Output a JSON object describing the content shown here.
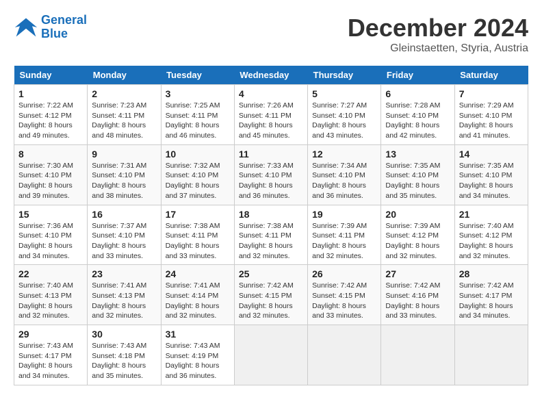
{
  "header": {
    "logo_general": "General",
    "logo_blue": "Blue",
    "month_title": "December 2024",
    "location": "Gleinstaetten, Styria, Austria"
  },
  "weekdays": [
    "Sunday",
    "Monday",
    "Tuesday",
    "Wednesday",
    "Thursday",
    "Friday",
    "Saturday"
  ],
  "weeks": [
    [
      {
        "day": "1",
        "info": "Sunrise: 7:22 AM\nSunset: 4:12 PM\nDaylight: 8 hours\nand 49 minutes."
      },
      {
        "day": "2",
        "info": "Sunrise: 7:23 AM\nSunset: 4:11 PM\nDaylight: 8 hours\nand 48 minutes."
      },
      {
        "day": "3",
        "info": "Sunrise: 7:25 AM\nSunset: 4:11 PM\nDaylight: 8 hours\nand 46 minutes."
      },
      {
        "day": "4",
        "info": "Sunrise: 7:26 AM\nSunset: 4:11 PM\nDaylight: 8 hours\nand 45 minutes."
      },
      {
        "day": "5",
        "info": "Sunrise: 7:27 AM\nSunset: 4:10 PM\nDaylight: 8 hours\nand 43 minutes."
      },
      {
        "day": "6",
        "info": "Sunrise: 7:28 AM\nSunset: 4:10 PM\nDaylight: 8 hours\nand 42 minutes."
      },
      {
        "day": "7",
        "info": "Sunrise: 7:29 AM\nSunset: 4:10 PM\nDaylight: 8 hours\nand 41 minutes."
      }
    ],
    [
      {
        "day": "8",
        "info": "Sunrise: 7:30 AM\nSunset: 4:10 PM\nDaylight: 8 hours\nand 39 minutes."
      },
      {
        "day": "9",
        "info": "Sunrise: 7:31 AM\nSunset: 4:10 PM\nDaylight: 8 hours\nand 38 minutes."
      },
      {
        "day": "10",
        "info": "Sunrise: 7:32 AM\nSunset: 4:10 PM\nDaylight: 8 hours\nand 37 minutes."
      },
      {
        "day": "11",
        "info": "Sunrise: 7:33 AM\nSunset: 4:10 PM\nDaylight: 8 hours\nand 36 minutes."
      },
      {
        "day": "12",
        "info": "Sunrise: 7:34 AM\nSunset: 4:10 PM\nDaylight: 8 hours\nand 36 minutes."
      },
      {
        "day": "13",
        "info": "Sunrise: 7:35 AM\nSunset: 4:10 PM\nDaylight: 8 hours\nand 35 minutes."
      },
      {
        "day": "14",
        "info": "Sunrise: 7:35 AM\nSunset: 4:10 PM\nDaylight: 8 hours\nand 34 minutes."
      }
    ],
    [
      {
        "day": "15",
        "info": "Sunrise: 7:36 AM\nSunset: 4:10 PM\nDaylight: 8 hours\nand 34 minutes."
      },
      {
        "day": "16",
        "info": "Sunrise: 7:37 AM\nSunset: 4:10 PM\nDaylight: 8 hours\nand 33 minutes."
      },
      {
        "day": "17",
        "info": "Sunrise: 7:38 AM\nSunset: 4:11 PM\nDaylight: 8 hours\nand 33 minutes."
      },
      {
        "day": "18",
        "info": "Sunrise: 7:38 AM\nSunset: 4:11 PM\nDaylight: 8 hours\nand 32 minutes."
      },
      {
        "day": "19",
        "info": "Sunrise: 7:39 AM\nSunset: 4:11 PM\nDaylight: 8 hours\nand 32 minutes."
      },
      {
        "day": "20",
        "info": "Sunrise: 7:39 AM\nSunset: 4:12 PM\nDaylight: 8 hours\nand 32 minutes."
      },
      {
        "day": "21",
        "info": "Sunrise: 7:40 AM\nSunset: 4:12 PM\nDaylight: 8 hours\nand 32 minutes."
      }
    ],
    [
      {
        "day": "22",
        "info": "Sunrise: 7:40 AM\nSunset: 4:13 PM\nDaylight: 8 hours\nand 32 minutes."
      },
      {
        "day": "23",
        "info": "Sunrise: 7:41 AM\nSunset: 4:13 PM\nDaylight: 8 hours\nand 32 minutes."
      },
      {
        "day": "24",
        "info": "Sunrise: 7:41 AM\nSunset: 4:14 PM\nDaylight: 8 hours\nand 32 minutes."
      },
      {
        "day": "25",
        "info": "Sunrise: 7:42 AM\nSunset: 4:15 PM\nDaylight: 8 hours\nand 32 minutes."
      },
      {
        "day": "26",
        "info": "Sunrise: 7:42 AM\nSunset: 4:15 PM\nDaylight: 8 hours\nand 33 minutes."
      },
      {
        "day": "27",
        "info": "Sunrise: 7:42 AM\nSunset: 4:16 PM\nDaylight: 8 hours\nand 33 minutes."
      },
      {
        "day": "28",
        "info": "Sunrise: 7:42 AM\nSunset: 4:17 PM\nDaylight: 8 hours\nand 34 minutes."
      }
    ],
    [
      {
        "day": "29",
        "info": "Sunrise: 7:43 AM\nSunset: 4:17 PM\nDaylight: 8 hours\nand 34 minutes."
      },
      {
        "day": "30",
        "info": "Sunrise: 7:43 AM\nSunset: 4:18 PM\nDaylight: 8 hours\nand 35 minutes."
      },
      {
        "day": "31",
        "info": "Sunrise: 7:43 AM\nSunset: 4:19 PM\nDaylight: 8 hours\nand 36 minutes."
      },
      null,
      null,
      null,
      null
    ]
  ]
}
